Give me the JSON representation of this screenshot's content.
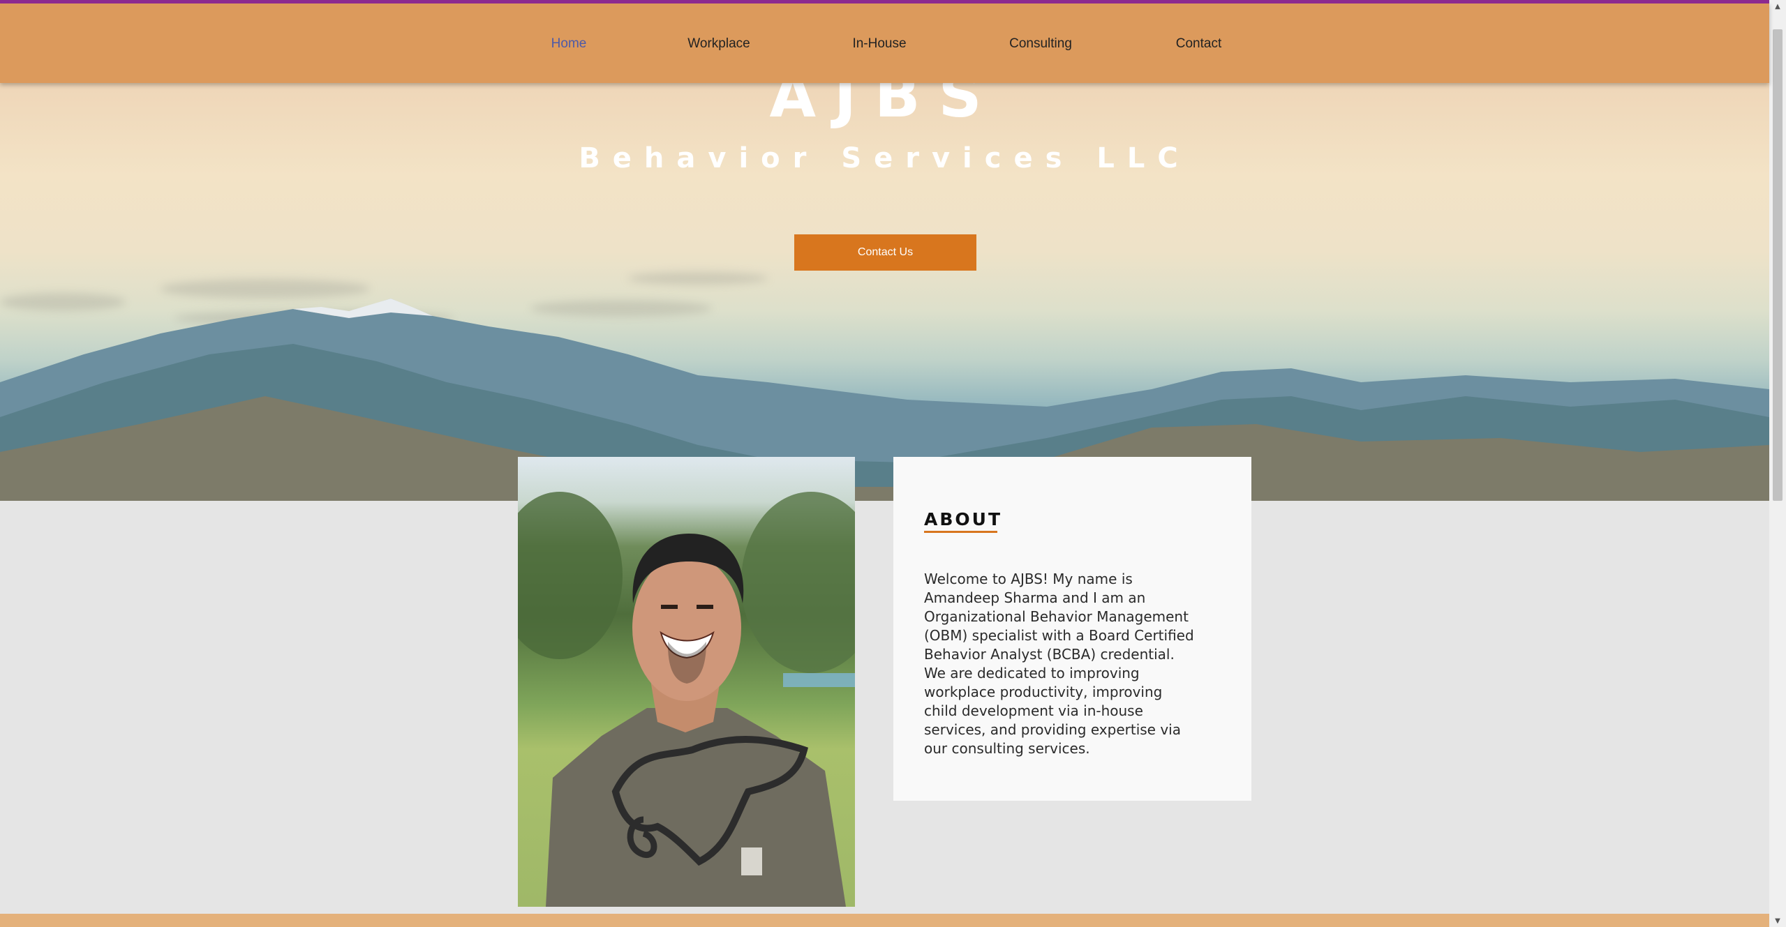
{
  "nav": {
    "items": [
      {
        "label": "Home",
        "active": true
      },
      {
        "label": "Workplace",
        "active": false
      },
      {
        "label": "In-House",
        "active": false
      },
      {
        "label": "Consulting",
        "active": false
      },
      {
        "label": "Contact",
        "active": false
      }
    ]
  },
  "hero": {
    "title": "AJBS",
    "subtitle": "Behavior Services LLC",
    "cta_label": "Contact Us"
  },
  "about": {
    "heading": "ABOUT",
    "body": "Welcome to AJBS! My name is Amandeep Sharma and I am an Organizational Behavior Management (OBM) specialist with a Board Certified Behavior Analyst (BCBA) credential. We are dedicated to improving workplace productivity, improving child development via in-house services, and providing expertise via our consulting services."
  },
  "colors": {
    "nav_bg": "#dc9a5c",
    "accent": "#d8761e",
    "active_nav": "#4d5aa8",
    "top_line": "#8d2a8f",
    "page_bg": "#e5e5e5"
  }
}
